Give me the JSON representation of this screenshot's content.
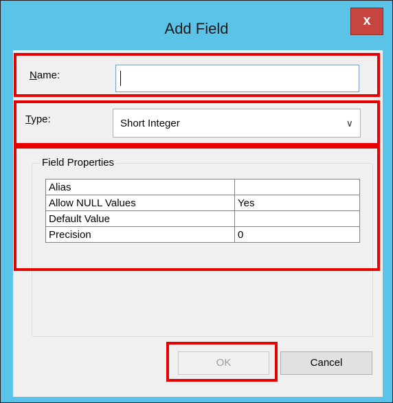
{
  "dialog": {
    "title": "Add Field",
    "close_glyph": "x"
  },
  "name_field": {
    "label_accel": "N",
    "label_rest": "ame:",
    "value": ""
  },
  "type_field": {
    "label_accel": "T",
    "label_rest": "ype:",
    "selected": "Short Integer"
  },
  "field_properties": {
    "title": "Field Properties",
    "rows": [
      {
        "key": "Alias",
        "value": ""
      },
      {
        "key": "Allow NULL Values",
        "value": "Yes"
      },
      {
        "key": "Default Value",
        "value": ""
      },
      {
        "key": "Precision",
        "value": "0"
      }
    ]
  },
  "buttons": {
    "ok": "OK",
    "cancel": "Cancel"
  },
  "highlight_color": "#e60000"
}
